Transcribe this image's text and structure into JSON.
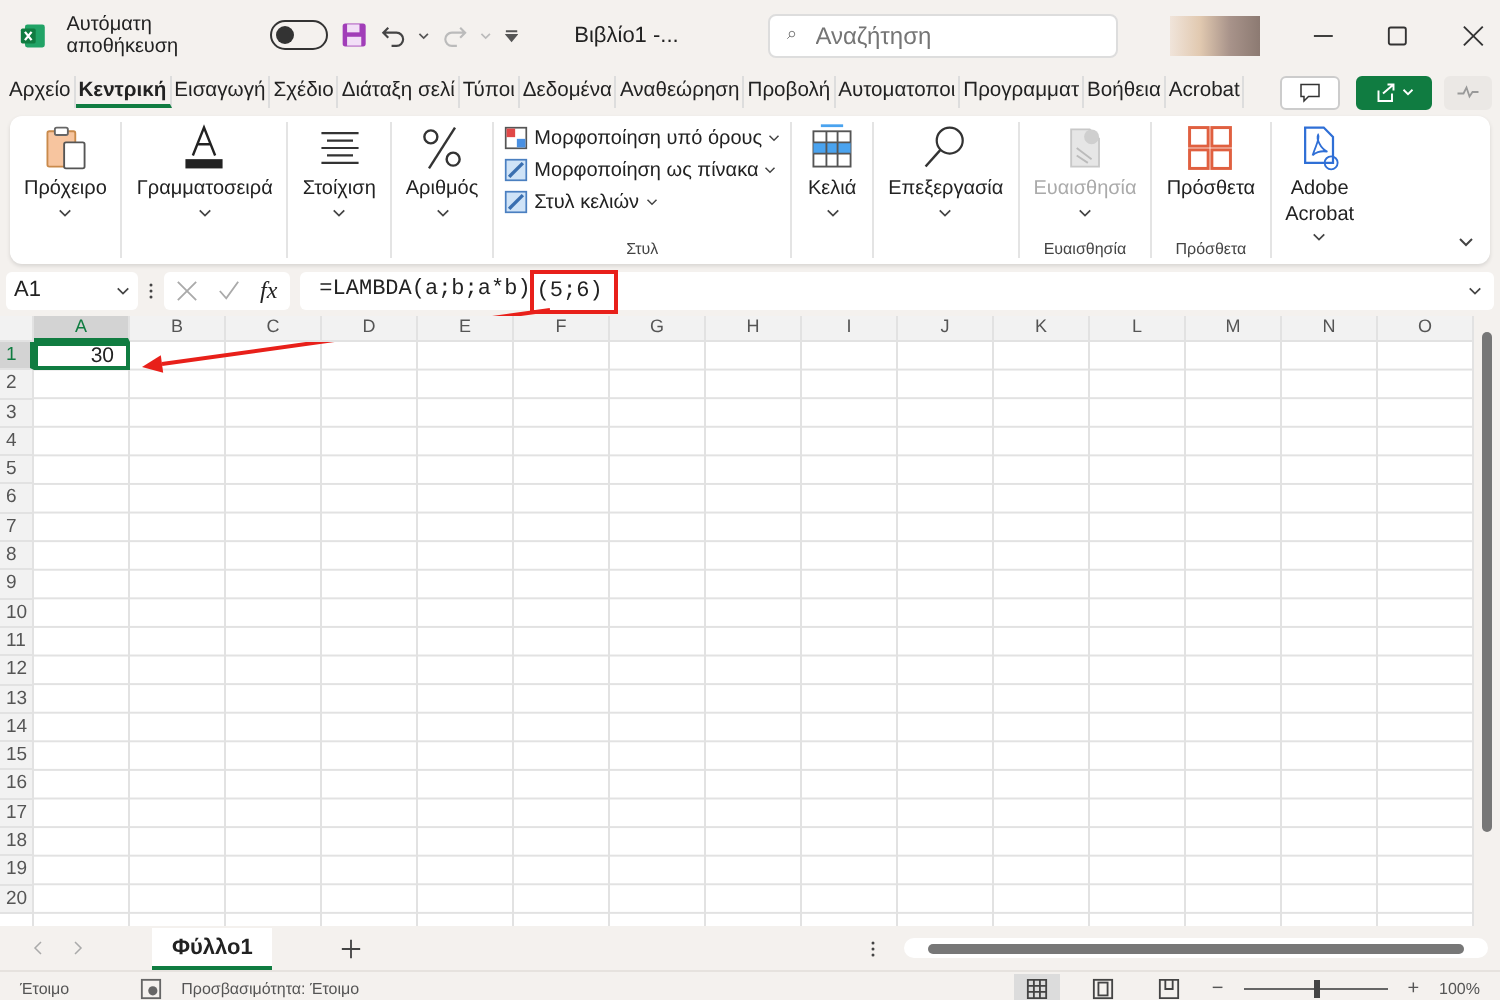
{
  "title_bar": {
    "autosave_label": "Αυτόματη αποθήκευση",
    "autosave_on": false,
    "document_title": "Βιβλίο1 -...",
    "search": {
      "placeholder": "Αναζήτηση"
    }
  },
  "tabs": [
    {
      "label": "Αρχείο",
      "selected": false
    },
    {
      "label": "Κεντρική",
      "selected": true
    },
    {
      "label": "Εισαγωγή",
      "selected": false
    },
    {
      "label": "Σχέδιο",
      "selected": false
    },
    {
      "label": "Διάταξη σελί",
      "selected": false
    },
    {
      "label": "Τύποι",
      "selected": false
    },
    {
      "label": "Δεδομένα",
      "selected": false
    },
    {
      "label": "Αναθεώρηση",
      "selected": false
    },
    {
      "label": "Προβολή",
      "selected": false
    },
    {
      "label": "Αυτοματοποι",
      "selected": false
    },
    {
      "label": "Προγραμματ",
      "selected": false
    },
    {
      "label": "Βοήθεια",
      "selected": false
    },
    {
      "label": "Acrobat",
      "selected": false
    }
  ],
  "ribbon": {
    "groups": [
      {
        "kind": "big",
        "label": "Πρόχειρο",
        "dropdown": true,
        "disabled": false
      },
      {
        "kind": "big",
        "label": "Γραμματοσειρά",
        "dropdown": true,
        "disabled": false
      },
      {
        "kind": "big",
        "label": "Στοίχιση",
        "dropdown": true,
        "disabled": false
      },
      {
        "kind": "big",
        "label": "Αριθμός",
        "dropdown": true,
        "disabled": false
      },
      {
        "kind": "stack",
        "items": [
          "Μορφοποίηση υπό όρους",
          "Μορφοποίηση ως πίνακα",
          "Στυλ κελιών"
        ],
        "group_label": "Στυλ"
      },
      {
        "kind": "big",
        "label": "Κελιά",
        "dropdown": true,
        "disabled": false
      },
      {
        "kind": "big",
        "label": "Επεξεργασία",
        "dropdown": true,
        "disabled": false
      },
      {
        "kind": "big",
        "label": "Ευαισθησία",
        "dropdown": true,
        "disabled": true,
        "group_label": "Ευαισθησία"
      },
      {
        "kind": "big",
        "label": "Πρόσθετα",
        "dropdown": false,
        "disabled": false,
        "group_label": "Πρόσθετα"
      },
      {
        "kind": "big",
        "label": "Adobe Acrobat",
        "dropdown": true,
        "disabled": false
      }
    ]
  },
  "formula_bar": {
    "name_box": "A1",
    "function_button": "fx",
    "formula": "=LAMBDA(a;b;a*b)",
    "formula_highlight": "(5;6)"
  },
  "grid": {
    "columns": [
      "A",
      "B",
      "C",
      "D",
      "E",
      "F",
      "G",
      "H",
      "I",
      "J",
      "K",
      "L",
      "M",
      "N",
      "O"
    ],
    "rows": [
      {
        "label": "1",
        "cells": [
          {
            "value": "30",
            "selected": true
          }
        ]
      },
      {
        "label": "2"
      },
      {
        "label": "3"
      },
      {
        "label": "4"
      },
      {
        "label": "5"
      },
      {
        "label": "6"
      },
      {
        "label": "7"
      },
      {
        "label": "8"
      },
      {
        "label": "9"
      },
      {
        "label": "10"
      },
      {
        "label": "11"
      },
      {
        "label": "12"
      },
      {
        "label": "13"
      },
      {
        "label": "14"
      },
      {
        "label": "15"
      },
      {
        "label": "16"
      },
      {
        "label": "17"
      },
      {
        "label": "18"
      },
      {
        "label": "19"
      },
      {
        "label": "20"
      }
    ]
  },
  "sheets": [
    {
      "label": "Φύλλο1",
      "selected": true
    }
  ],
  "status_bar": {
    "ready": "Έτοιμο",
    "accessibility": "Προσβασιμότητα: Έτοιμο",
    "views": [
      {
        "selected": true
      },
      {
        "selected": false
      },
      {
        "selected": false
      }
    ],
    "zoom": {
      "minus": "−",
      "level": 0.5,
      "plus": "+",
      "label": "100%"
    }
  }
}
